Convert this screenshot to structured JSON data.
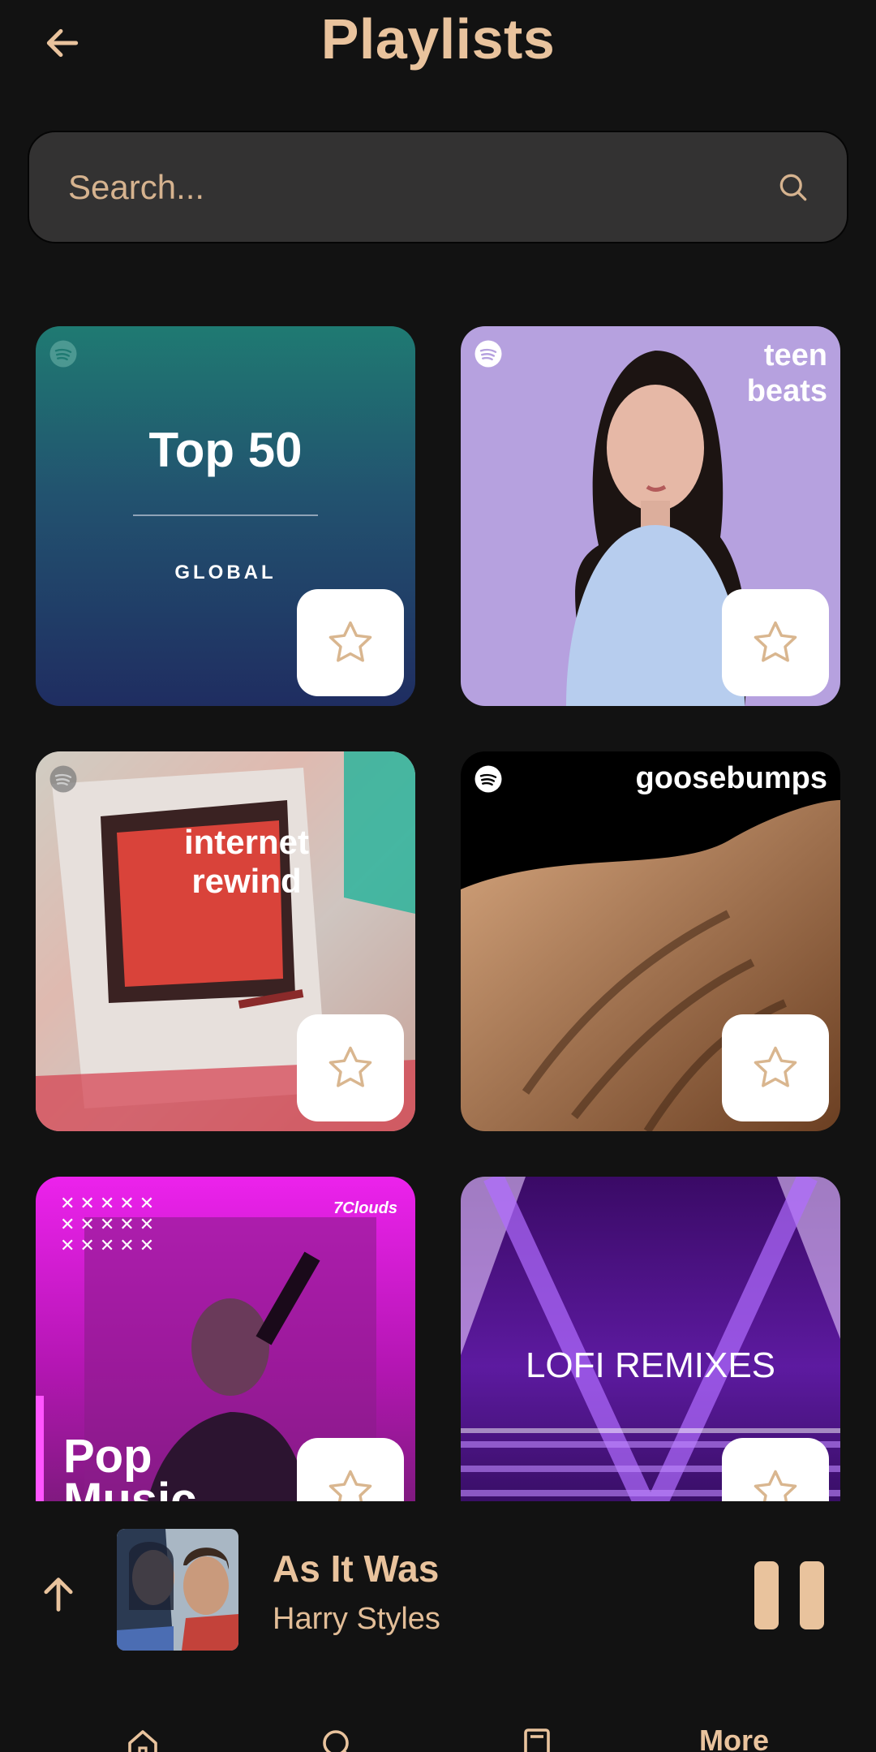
{
  "header": {
    "title": "Playlists"
  },
  "search": {
    "placeholder": "Search..."
  },
  "playlists": [
    {
      "line1": "Top 50",
      "line2": "GLOBAL"
    },
    {
      "line1": "teen",
      "line2": "beats"
    },
    {
      "line1": "internet",
      "line2": "rewind"
    },
    {
      "line1": "goosebumps"
    },
    {
      "line1": "Pop",
      "line2": "Music",
      "badge": "7Clouds"
    },
    {
      "line1": "LOFI REMIXES"
    }
  ],
  "player": {
    "title": "As It Was",
    "artist": "Harry Styles"
  },
  "nav": {
    "more_label": "More"
  },
  "colors": {
    "accent": "#e9c39d",
    "background": "#121212",
    "search_bg": "#333232"
  }
}
